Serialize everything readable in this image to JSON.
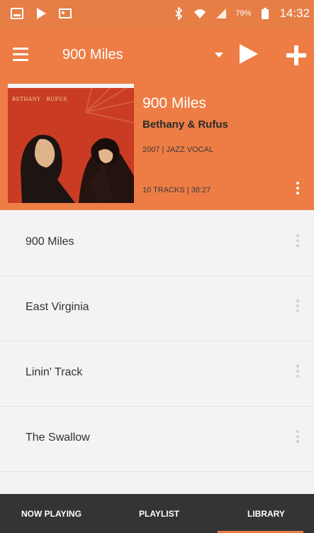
{
  "status_bar": {
    "battery": "79%",
    "time": "14:32"
  },
  "toolbar": {
    "title": "900 Miles"
  },
  "album": {
    "art_label": "BETHANY · RUFUS",
    "title": "900 Miles",
    "artist": "Bethany & Rufus",
    "meta": "2007 | JAZZ VOCAL",
    "tracks_meta": "10 TRACKS | 38:27"
  },
  "tracks": [
    {
      "title": "900 Miles"
    },
    {
      "title": "East Virginia"
    },
    {
      "title": "Linin' Track"
    },
    {
      "title": "The Swallow"
    }
  ],
  "bottom_nav": {
    "tabs": [
      {
        "label": "NOW PLAYING"
      },
      {
        "label": "PLAYLIST"
      },
      {
        "label": "LIBRARY"
      }
    ]
  },
  "colors": {
    "accent": "#ed7d45",
    "nav_background": "#343434"
  },
  "icons": {
    "menu": "menu-icon",
    "dropdown": "dropdown-arrow-icon",
    "play": "play-icon",
    "add": "plus-icon",
    "more": "more-vert-icon"
  }
}
